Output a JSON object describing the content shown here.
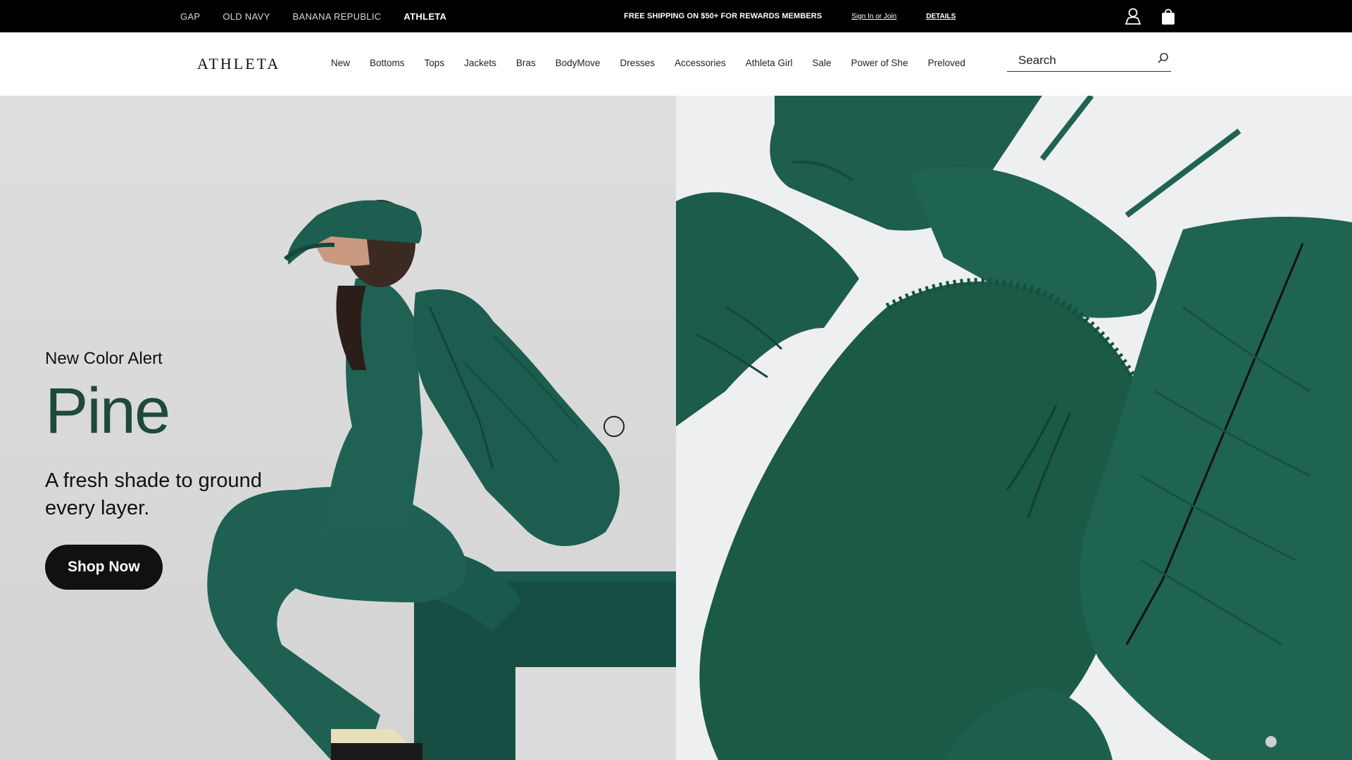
{
  "topbar": {
    "brands": [
      {
        "label": "GAP"
      },
      {
        "label": "OLD NAVY"
      },
      {
        "label": "BANANA REPUBLIC"
      },
      {
        "label": "ATHLETA",
        "active": true
      }
    ],
    "promo_message": "FREE SHIPPING ON $50+ FOR REWARDS MEMBERS",
    "signin_label": "Sign In or Join",
    "details_label": "DETAILS",
    "icons": [
      "account-icon",
      "shopping-bag-icon"
    ]
  },
  "header": {
    "logo_text": "ATHLETA",
    "nav_items": [
      "New",
      "Bottoms",
      "Tops",
      "Jackets",
      "Bras",
      "BodyMove",
      "Dresses",
      "Accessories",
      "Athleta Girl",
      "Sale",
      "Power of She",
      "Preloved"
    ],
    "search": {
      "placeholder": "Search",
      "icon": "search-icon"
    }
  },
  "hero": {
    "eyebrow": "New Color Alert",
    "headline": "Pine",
    "subline": "A fresh shade to ground every layer.",
    "cta_label": "Shop Now",
    "colors": {
      "accent": "#1d4a3a",
      "garment": "#1f5a4a",
      "button": "#111111"
    }
  }
}
